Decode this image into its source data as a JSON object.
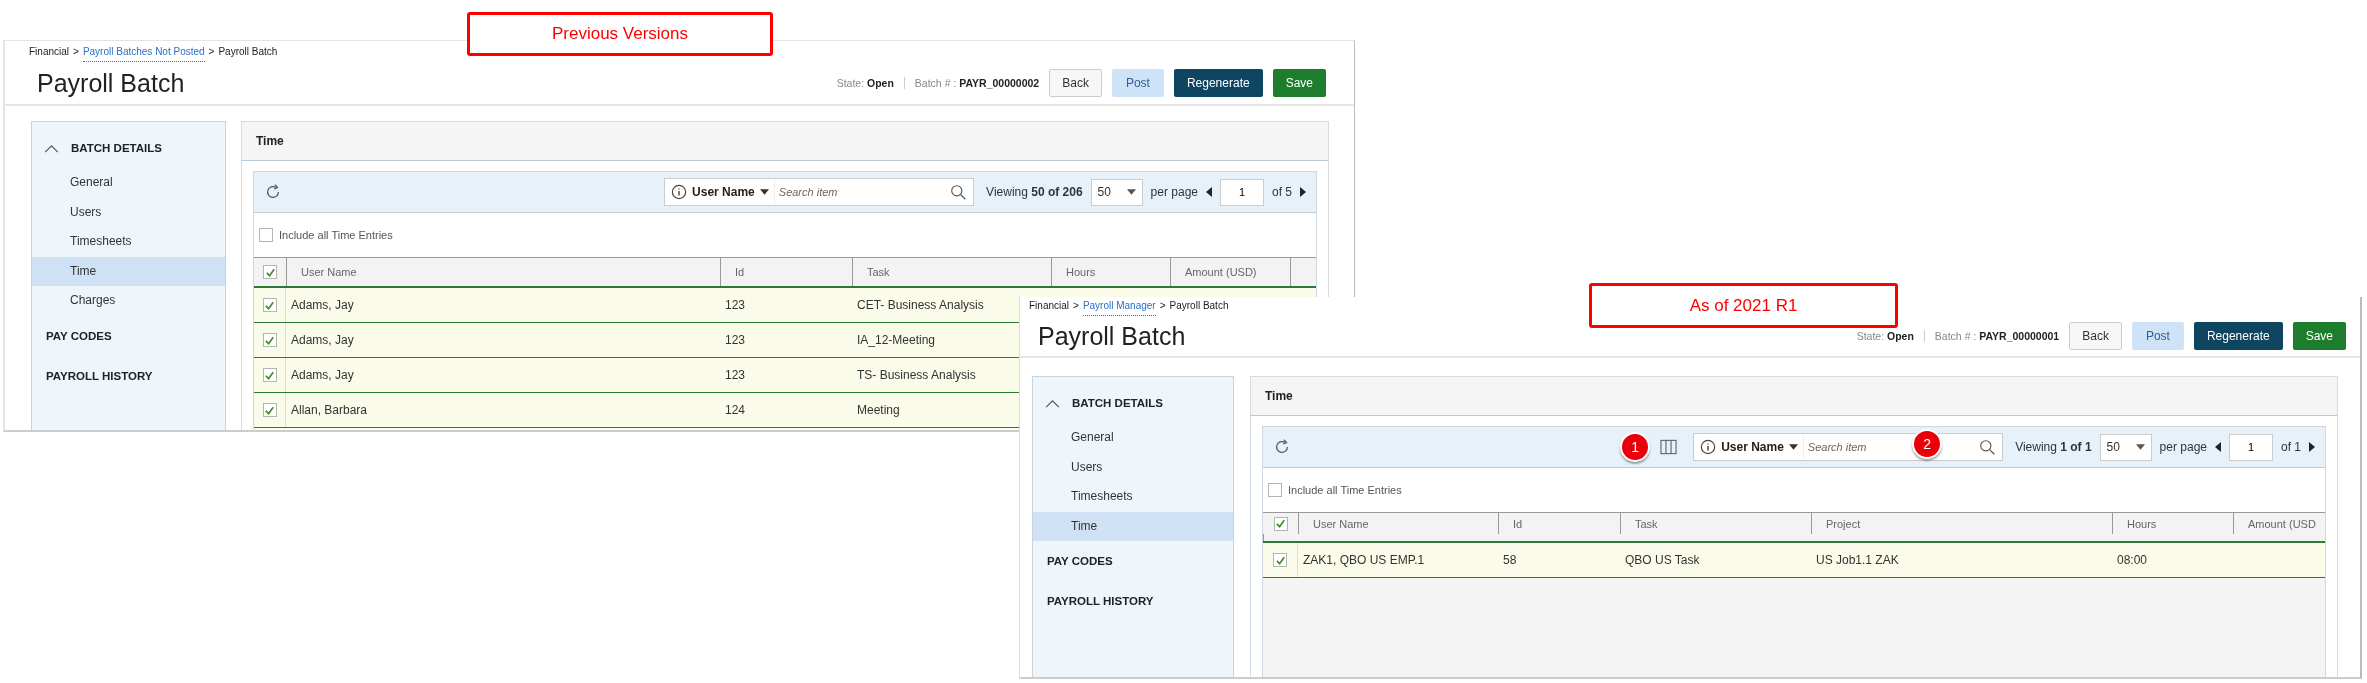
{
  "callouts": [
    {
      "text": "Previous Versions"
    },
    {
      "text": "As of 2021 R1"
    }
  ],
  "screens": [
    {
      "breadcrumb": [
        {
          "kind": "text",
          "text": "Financial"
        },
        {
          "kind": "separator",
          "text": ">"
        },
        {
          "kind": "link",
          "text": "Payroll Batches Not Posted"
        },
        {
          "kind": "separator",
          "text": ">"
        },
        {
          "kind": "text",
          "text": "Payroll Batch"
        }
      ],
      "title": "Payroll Batch",
      "state": "State: **Open**",
      "batch": "Batch # : **PAYR_00000002**",
      "buttons": [
        {
          "label": "Back",
          "kind": "default"
        },
        {
          "label": "Post",
          "kind": "light"
        },
        {
          "label": "Regenerate",
          "kind": "dark"
        },
        {
          "label": "Save",
          "kind": "success"
        }
      ],
      "sidebar": [
        {
          "label": "BATCH DETAILS",
          "expanded": true,
          "children": [
            {
              "label": "General",
              "selected": false
            },
            {
              "label": "Users",
              "selected": false
            },
            {
              "label": "Timesheets",
              "selected": false
            },
            {
              "label": "Time",
              "selected": true
            },
            {
              "label": "Charges",
              "selected": false
            }
          ]
        },
        {
          "label": "PAY CODES"
        },
        {
          "label": "PAYROLL HISTORY"
        }
      ],
      "panel_title": "Time",
      "grid": {
        "search": {
          "field": "User Name",
          "placeholder": "Search item"
        },
        "viewing": "Viewing **50 of 206**",
        "per_page_value": "50",
        "per_page_label": "per page",
        "page": "1",
        "page_count": "of 5",
        "include_all": {
          "label": "Include all Time Entries",
          "checked": false
        },
        "select_all": true,
        "columns": [
          "User Name",
          "Id",
          "Task",
          "Hours",
          "Amount (USD)"
        ],
        "rows": [
          {
            "checked": true,
            "cells": [
              "Adams, Jay",
              "123",
              "CET- Business Analysis"
            ]
          },
          {
            "checked": true,
            "cells": [
              "Adams, Jay",
              "123",
              "IA_12-Meeting"
            ]
          },
          {
            "checked": true,
            "cells": [
              "Adams, Jay",
              "123",
              "TS- Business Analysis"
            ]
          },
          {
            "checked": true,
            "cells": [
              "Allan, Barbara",
              "124",
              "Meeting"
            ]
          }
        ]
      }
    },
    {
      "breadcrumb": [
        {
          "kind": "text",
          "text": "Financial"
        },
        {
          "kind": "separator",
          "text": ">"
        },
        {
          "kind": "link",
          "text": "Payroll Manager"
        },
        {
          "kind": "separator",
          "text": ">"
        },
        {
          "kind": "text",
          "text": "Payroll Batch"
        }
      ],
      "title": "Payroll Batch",
      "state": "State: **Open**",
      "batch": "Batch # : **PAYR_00000001**",
      "buttons": [
        {
          "label": "Back",
          "kind": "default"
        },
        {
          "label": "Post",
          "kind": "light"
        },
        {
          "label": "Regenerate",
          "kind": "dark"
        },
        {
          "label": "Save",
          "kind": "success"
        }
      ],
      "sidebar": [
        {
          "label": "BATCH DETAILS",
          "expanded": true,
          "children": [
            {
              "label": "General",
              "selected": false
            },
            {
              "label": "Users",
              "selected": false
            },
            {
              "label": "Timesheets",
              "selected": false
            },
            {
              "label": "Time",
              "selected": true
            }
          ]
        },
        {
          "label": "PAY CODES"
        },
        {
          "label": "PAYROLL HISTORY"
        }
      ],
      "panel_title": "Time",
      "grid": {
        "column_chooser": {
          "badge": "1"
        },
        "search": {
          "field": "User Name",
          "placeholder": "Search item",
          "badge": "2"
        },
        "viewing": "Viewing **1 of 1**",
        "per_page_value": "50",
        "per_page_label": "per page",
        "page": "1",
        "page_count": "of 1",
        "include_all": {
          "label": "Include all Time Entries",
          "checked": false
        },
        "select_all": true,
        "columns": [
          "User Name",
          "Id",
          "Task",
          "Project",
          "Hours",
          "Amount (USD"
        ],
        "rows": [
          {
            "checked": true,
            "cells": [
              "ZAK1, QBO US EMP.1",
              "58",
              "QBO US Task",
              "US Job1.1 ZAK",
              "08:00"
            ]
          }
        ]
      }
    }
  ]
}
